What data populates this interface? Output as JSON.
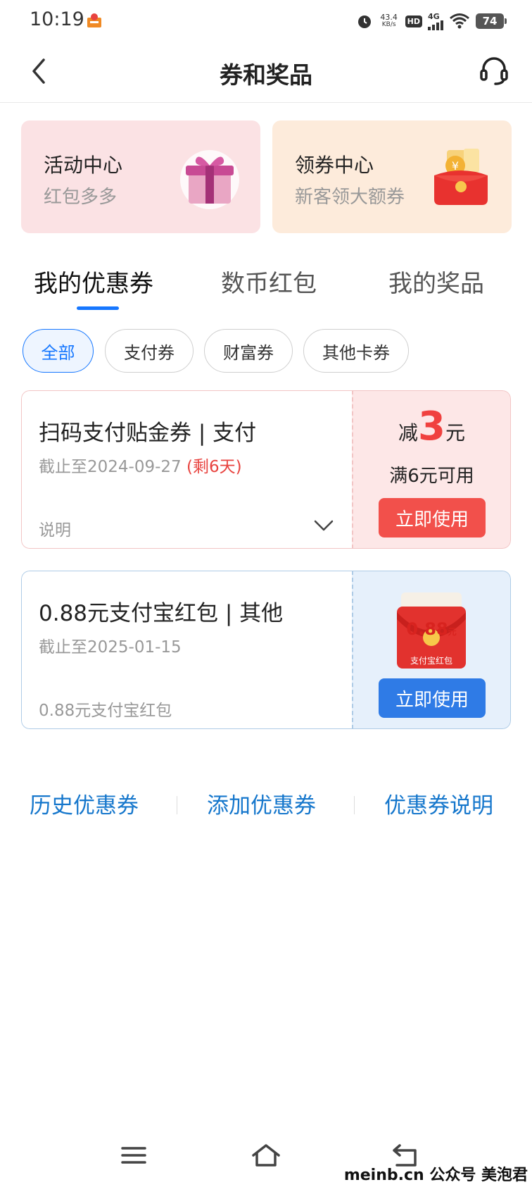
{
  "status_bar": {
    "time": "10:19",
    "net_speed_value": "43.4",
    "net_speed_unit": "KB/s",
    "hd": "HD",
    "signal": "4G",
    "battery": "74"
  },
  "header": {
    "title": "券和奖品"
  },
  "promos": [
    {
      "title": "活动中心",
      "subtitle": "红包多多",
      "icon": "gift-box-icon"
    },
    {
      "title": "领券中心",
      "subtitle": "新客领大额券",
      "icon": "red-envelope-icon"
    }
  ],
  "tabs": [
    {
      "label": "我的优惠券",
      "active": true
    },
    {
      "label": "数币红包",
      "active": false
    },
    {
      "label": "我的奖品",
      "active": false
    }
  ],
  "filters": [
    {
      "label": "全部",
      "active": true
    },
    {
      "label": "支付券",
      "active": false
    },
    {
      "label": "财富券",
      "active": false
    },
    {
      "label": "其他卡券",
      "active": false
    }
  ],
  "coupons": [
    {
      "title": "扫码支付贴金券 | 支付",
      "expiry": "截止至2024-09-27",
      "remaining": "(剩6天)",
      "footer": "说明",
      "discount_prefix": "减",
      "discount_amount": "3",
      "discount_unit": "元",
      "condition": "满6元可用",
      "button": "立即使用",
      "accent": "#f2504b"
    },
    {
      "title": "0.88元支付宝红包 | 其他",
      "expiry": "截止至2025-01-15",
      "footer": "0.88元支付宝红包",
      "packet_amount": "0.88",
      "packet_unit": "元",
      "packet_label": "支付宝红包",
      "button": "立即使用",
      "accent": "#2f7be6"
    }
  ],
  "bottom_links": [
    "历史优惠券",
    "添加优惠券",
    "优惠券说明"
  ],
  "watermark": "meinb.cn  公众号 美泡君"
}
